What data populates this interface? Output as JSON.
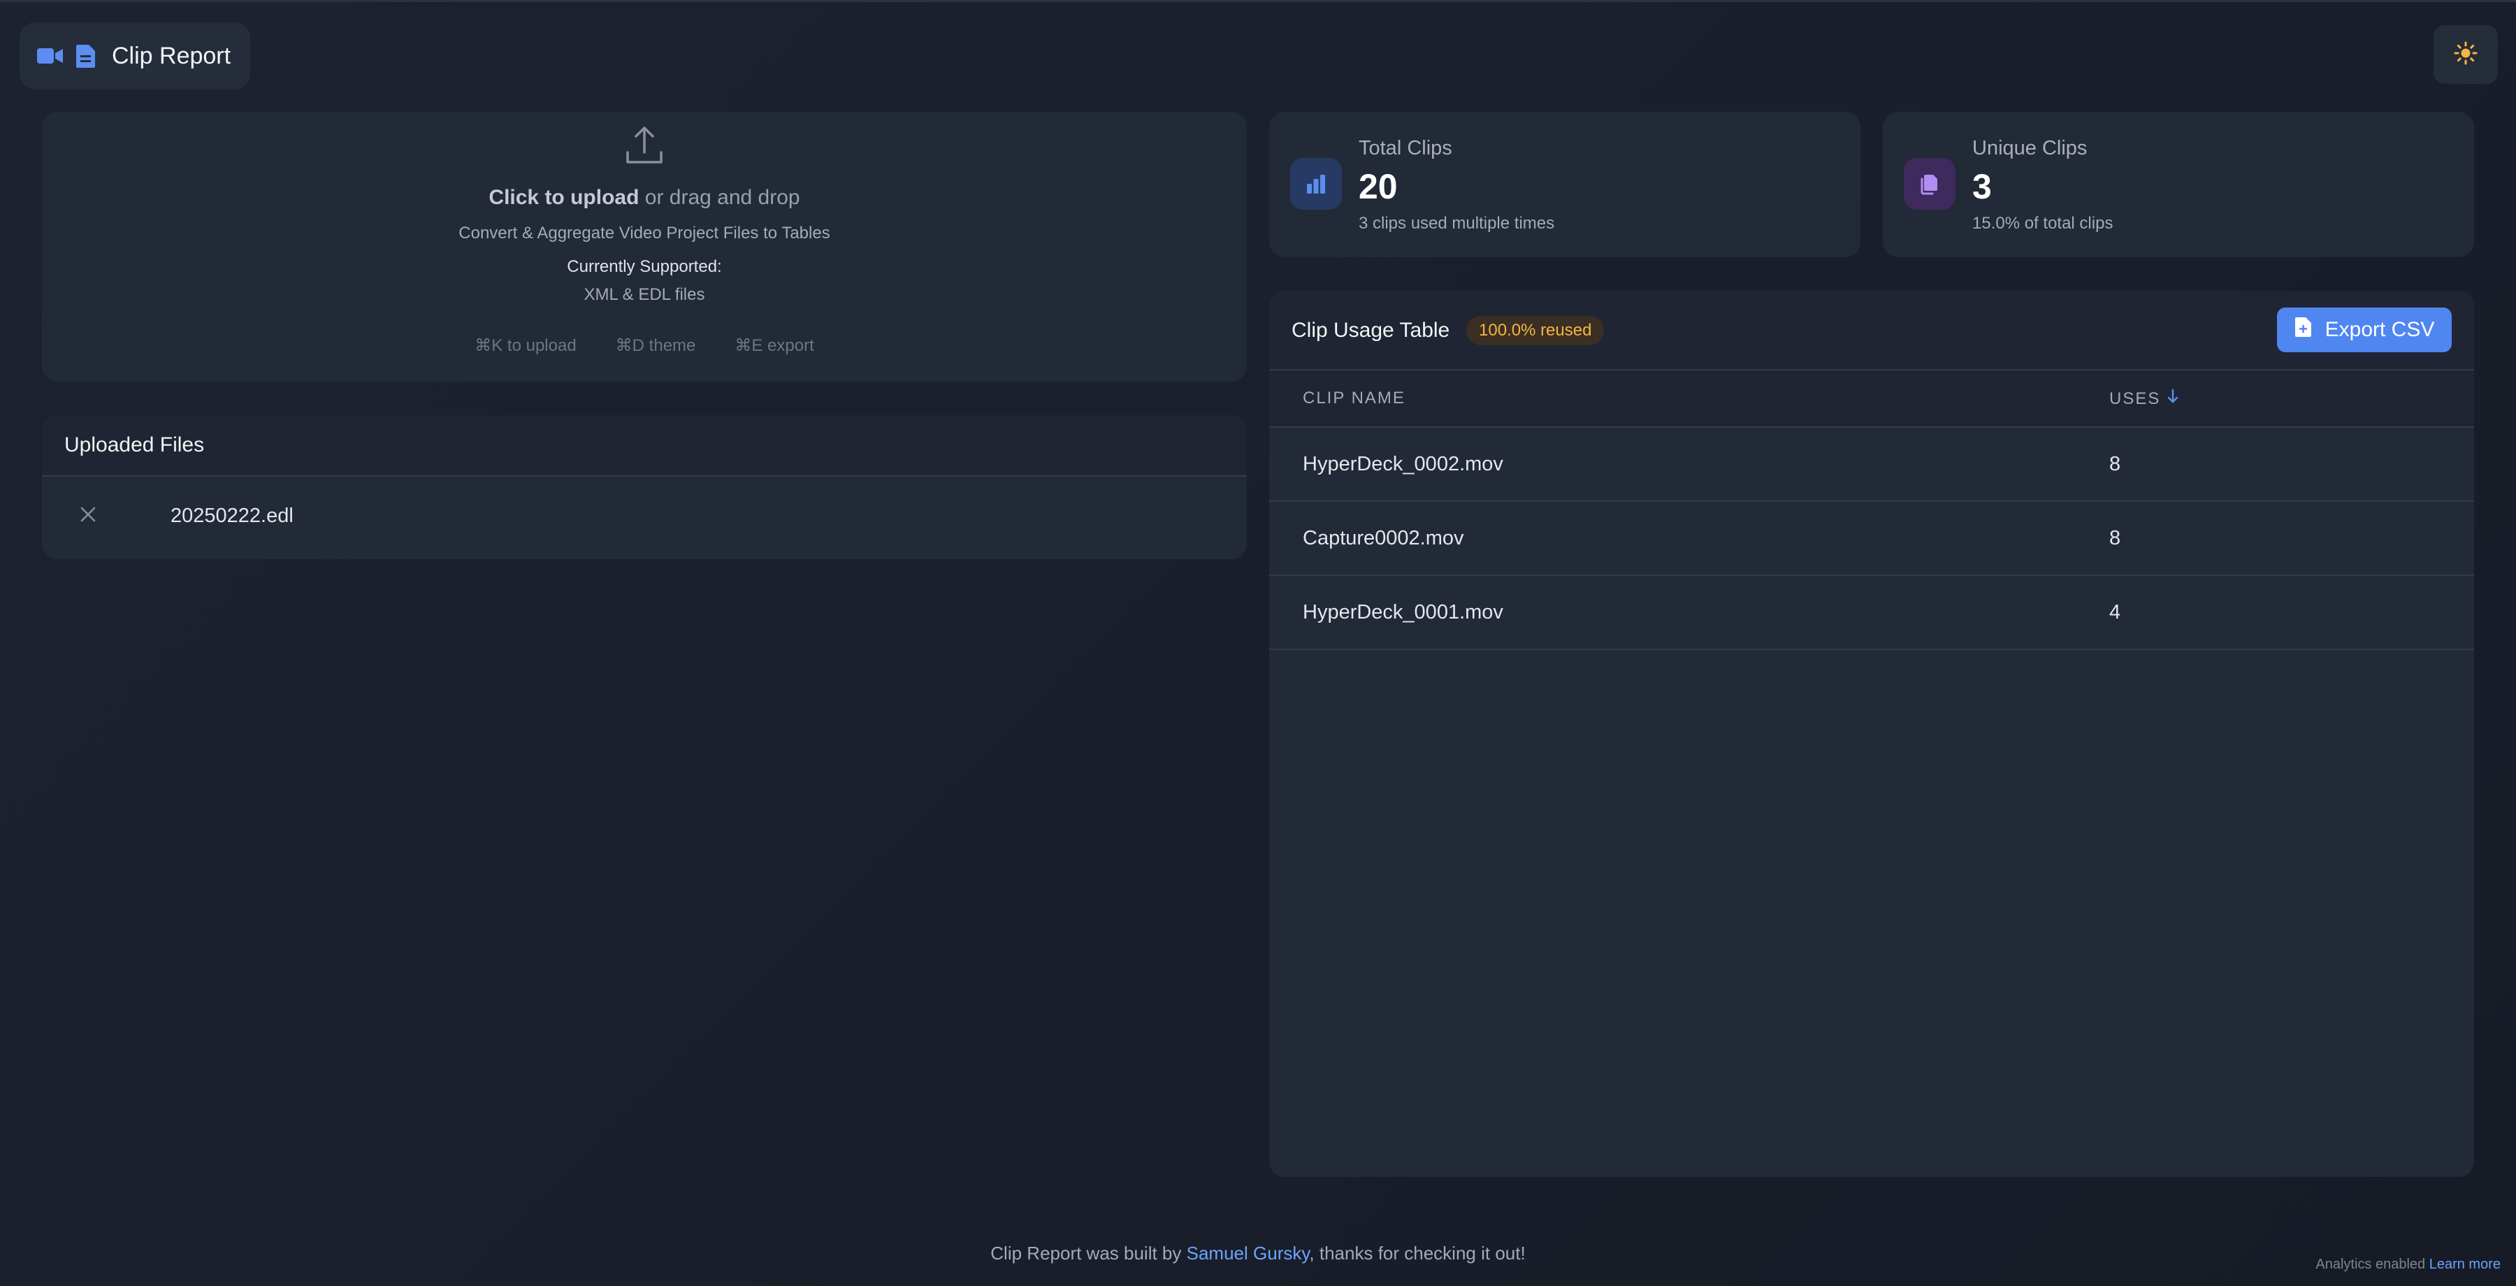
{
  "brand": {
    "title": "Clip Report"
  },
  "upload": {
    "action": "Click to upload",
    "action_rest": " or drag and drop",
    "description": "Convert & Aggregate Video Project Files to Tables",
    "supported_label": "Currently Supported:",
    "supported_formats": "XML & EDL files",
    "shortcuts": [
      "⌘K to upload",
      "⌘D theme",
      "⌘E export"
    ]
  },
  "files": {
    "title": "Uploaded Files",
    "items": [
      {
        "name": "20250222.edl"
      }
    ]
  },
  "stats": {
    "total": {
      "label": "Total Clips",
      "value": "20",
      "sub": "3 clips used multiple times"
    },
    "unique": {
      "label": "Unique Clips",
      "value": "3",
      "sub": "15.0% of total clips"
    }
  },
  "table": {
    "title": "Clip Usage Table",
    "badge": "100.0% reused",
    "export_label": "Export CSV",
    "columns": {
      "name": "CLIP NAME",
      "uses": "USES"
    },
    "rows": [
      {
        "name": "HyperDeck_0002.mov",
        "uses": "8"
      },
      {
        "name": "Capture0002.mov",
        "uses": "8"
      },
      {
        "name": "HyperDeck_0001.mov",
        "uses": "4"
      }
    ]
  },
  "footer": {
    "prefix": "Clip Report was built by ",
    "author": "Samuel Gursky",
    "suffix": ", thanks for checking it out!",
    "analytics": "Analytics enabled",
    "learn_more": "Learn more"
  },
  "icons": {
    "video": "video-camera-icon",
    "document": "document-icon",
    "theme": "sun-icon",
    "upload": "upload-icon",
    "close": "close-icon",
    "bar_chart": "bar-chart-icon",
    "copy": "copy-files-icon",
    "export": "file-export-icon",
    "sort": "arrow-down-icon"
  },
  "colors": {
    "accent": "#4f86f0",
    "badge_text": "#f5b544",
    "link": "#6ea3ff",
    "sun": "#f5b544"
  }
}
